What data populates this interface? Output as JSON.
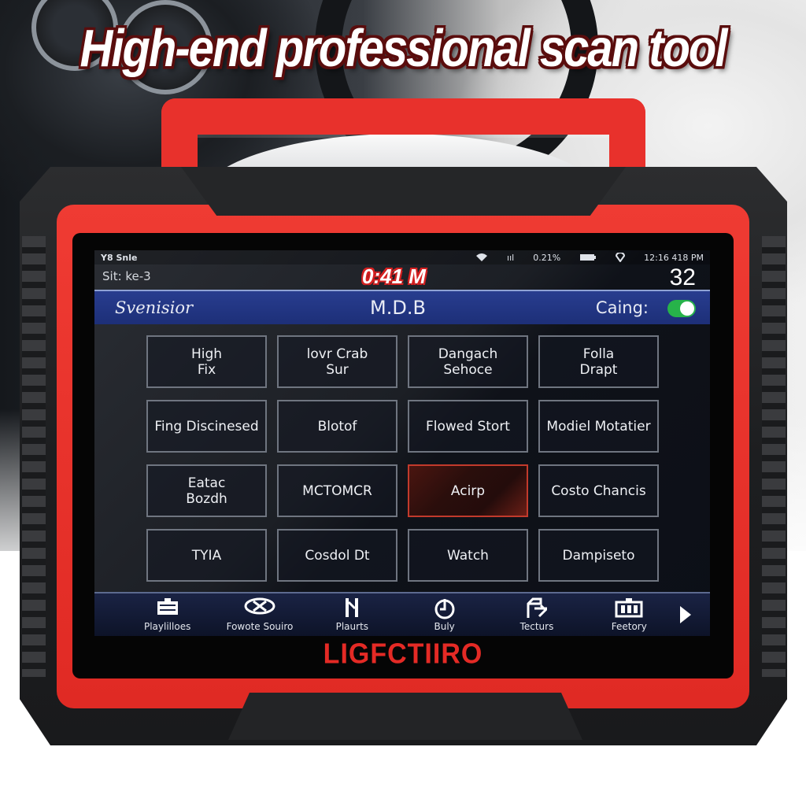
{
  "headline": "High-end professional scan tool",
  "device": {
    "brand": "LIGFCTIIRO",
    "brand_color": "#e42a25",
    "body_color": "#e8312c",
    "bumper_color": "#1d1e20"
  },
  "screen": {
    "status_bar": {
      "left_text": "Y8 Snle",
      "wifi_icon": "wifi-icon",
      "signal_text": "ııl",
      "battery_percent": "0.21%",
      "battery_icon": "battery-icon",
      "location_icon": "location-pin-icon",
      "clock": "12:16 418 PM"
    },
    "subheader": {
      "left_text": "Sit: ke-3",
      "center_text": "0:41 M",
      "right_value": "32"
    },
    "title_bar": {
      "left_text": "Svenisior",
      "center_text": "M.D.B",
      "right_label": "Caing:",
      "toggle_on": true,
      "toggle_color": "#27b34a"
    },
    "tiles": [
      {
        "label": "High\nFix"
      },
      {
        "label": "lovr Crab\nSur"
      },
      {
        "label": "Dangach\nSehoce"
      },
      {
        "label": "Folla\nDrapt"
      },
      {
        "label": "Fing Discinesed"
      },
      {
        "label": "Blotof"
      },
      {
        "label": "Flowed Stort"
      },
      {
        "label": "Modiel Motatier"
      },
      {
        "label": "Eatac\nBozdh"
      },
      {
        "label": "MCTOMCR"
      },
      {
        "label": "Acirp",
        "active": true
      },
      {
        "label": "Costo Chancis"
      },
      {
        "label": "TYIA"
      },
      {
        "label": "Cosdol Dt"
      },
      {
        "label": "Watch"
      },
      {
        "label": "Dampiseto"
      }
    ],
    "bottom_nav": [
      {
        "label": "Playlilloes",
        "icon": "toolbox-icon",
        "glyph": "🧰"
      },
      {
        "label": "Fowote Souiro",
        "icon": "car-badge-icon",
        "glyph": "⬭"
      },
      {
        "label": "Plaurts",
        "icon": "bracket-icon",
        "glyph": "Ⲛ"
      },
      {
        "label": "Buly",
        "icon": "timer-icon",
        "glyph": "◷"
      },
      {
        "label": "Tecturs",
        "icon": "tools-icon",
        "glyph": "⚒"
      },
      {
        "label": "Feetory",
        "icon": "battery-icon",
        "glyph": "▥"
      }
    ],
    "next_icon": "chevron-right-icon"
  }
}
